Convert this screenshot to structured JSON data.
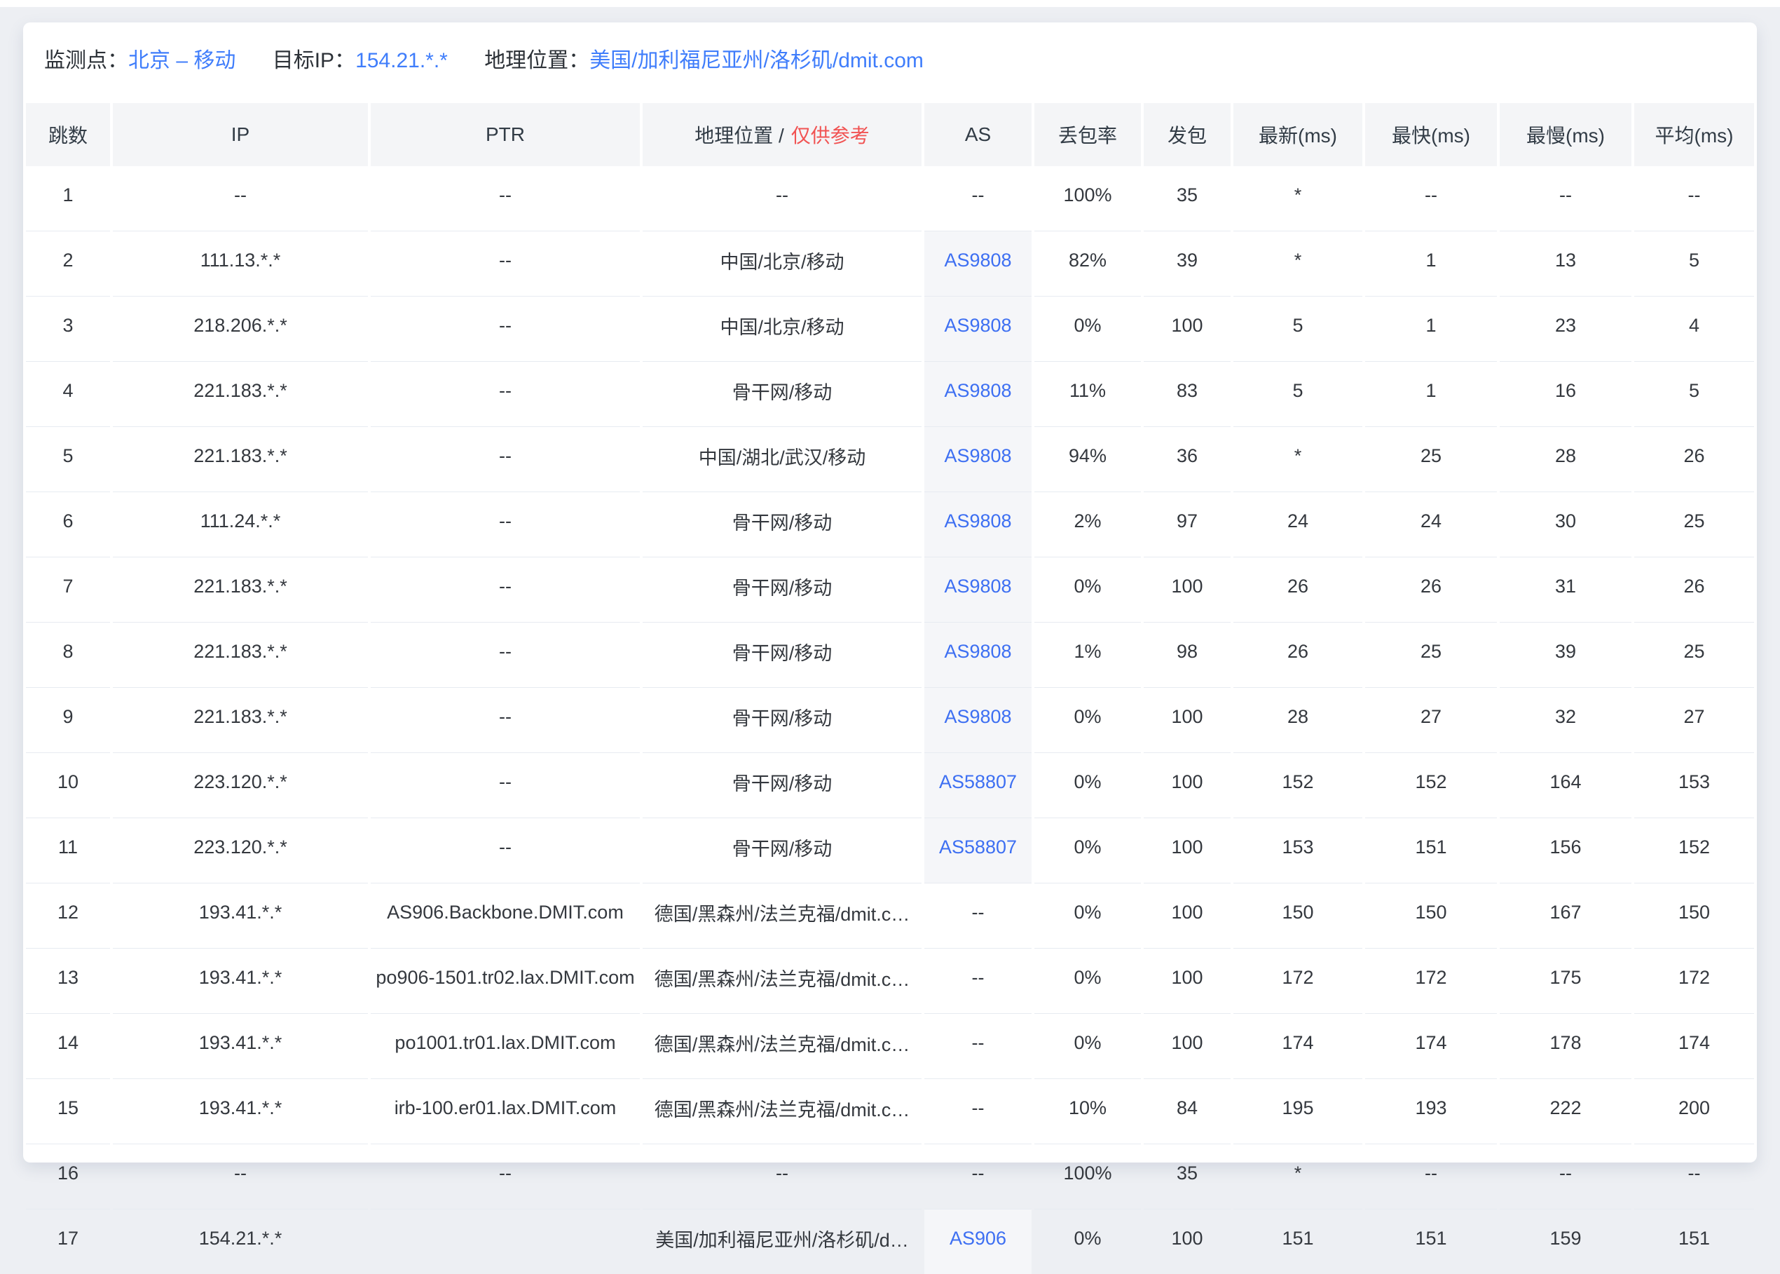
{
  "colors": {
    "page_background": "#edeff3",
    "link_blue": "#3f7dfb",
    "as_link_blue": "#3d6ff2",
    "warning_red": "#f15353",
    "header_cell_bg": "#f4f5f7",
    "as_cell_bg": "#f5f6f9"
  },
  "info": {
    "monitor_label": "监测点：",
    "monitor_value": "北京 – 移动",
    "target_ip_label": "目标IP：",
    "target_ip_value": "154.21.*.*",
    "location_label": "地理位置：",
    "location_value": "美国/加利福尼亚州/洛杉矶/dmit.com"
  },
  "table": {
    "columns": [
      "跳数",
      "IP",
      "PTR",
      "地理位置 /",
      "AS",
      "丢包率",
      "发包",
      "最新(ms)",
      "最快(ms)",
      "最慢(ms)",
      "平均(ms)"
    ],
    "geo_note": "仅供参考",
    "rows": [
      {
        "hop": "1",
        "ip": "--",
        "ptr": "--",
        "geo": "--",
        "as": "--",
        "as_link": false,
        "loss": "100%",
        "sent": "35",
        "latest": "*",
        "fastest": "--",
        "slowest": "--",
        "avg": "--"
      },
      {
        "hop": "2",
        "ip": "111.13.*.*",
        "ptr": "--",
        "geo": "中国/北京/移动",
        "as": "AS9808",
        "as_link": true,
        "loss": "82%",
        "sent": "39",
        "latest": "*",
        "fastest": "1",
        "slowest": "13",
        "avg": "5"
      },
      {
        "hop": "3",
        "ip": "218.206.*.*",
        "ptr": "--",
        "geo": "中国/北京/移动",
        "as": "AS9808",
        "as_link": true,
        "loss": "0%",
        "sent": "100",
        "latest": "5",
        "fastest": "1",
        "slowest": "23",
        "avg": "4"
      },
      {
        "hop": "4",
        "ip": "221.183.*.*",
        "ptr": "--",
        "geo": "骨干网/移动",
        "as": "AS9808",
        "as_link": true,
        "loss": "11%",
        "sent": "83",
        "latest": "5",
        "fastest": "1",
        "slowest": "16",
        "avg": "5"
      },
      {
        "hop": "5",
        "ip": "221.183.*.*",
        "ptr": "--",
        "geo": "中国/湖北/武汉/移动",
        "as": "AS9808",
        "as_link": true,
        "loss": "94%",
        "sent": "36",
        "latest": "*",
        "fastest": "25",
        "slowest": "28",
        "avg": "26"
      },
      {
        "hop": "6",
        "ip": "111.24.*.*",
        "ptr": "--",
        "geo": "骨干网/移动",
        "as": "AS9808",
        "as_link": true,
        "loss": "2%",
        "sent": "97",
        "latest": "24",
        "fastest": "24",
        "slowest": "30",
        "avg": "25"
      },
      {
        "hop": "7",
        "ip": "221.183.*.*",
        "ptr": "--",
        "geo": "骨干网/移动",
        "as": "AS9808",
        "as_link": true,
        "loss": "0%",
        "sent": "100",
        "latest": "26",
        "fastest": "26",
        "slowest": "31",
        "avg": "26"
      },
      {
        "hop": "8",
        "ip": "221.183.*.*",
        "ptr": "--",
        "geo": "骨干网/移动",
        "as": "AS9808",
        "as_link": true,
        "loss": "1%",
        "sent": "98",
        "latest": "26",
        "fastest": "25",
        "slowest": "39",
        "avg": "25"
      },
      {
        "hop": "9",
        "ip": "221.183.*.*",
        "ptr": "--",
        "geo": "骨干网/移动",
        "as": "AS9808",
        "as_link": true,
        "loss": "0%",
        "sent": "100",
        "latest": "28",
        "fastest": "27",
        "slowest": "32",
        "avg": "27"
      },
      {
        "hop": "10",
        "ip": "223.120.*.*",
        "ptr": "--",
        "geo": "骨干网/移动",
        "as": "AS58807",
        "as_link": true,
        "loss": "0%",
        "sent": "100",
        "latest": "152",
        "fastest": "152",
        "slowest": "164",
        "avg": "153"
      },
      {
        "hop": "11",
        "ip": "223.120.*.*",
        "ptr": "--",
        "geo": "骨干网/移动",
        "as": "AS58807",
        "as_link": true,
        "loss": "0%",
        "sent": "100",
        "latest": "153",
        "fastest": "151",
        "slowest": "156",
        "avg": "152"
      },
      {
        "hop": "12",
        "ip": "193.41.*.*",
        "ptr": "AS906.Backbone.DMIT.com",
        "geo": "德国/黑森州/法兰克福/dmit.c…",
        "as": "--",
        "as_link": false,
        "loss": "0%",
        "sent": "100",
        "latest": "150",
        "fastest": "150",
        "slowest": "167",
        "avg": "150"
      },
      {
        "hop": "13",
        "ip": "193.41.*.*",
        "ptr": "po906-1501.tr02.lax.DMIT.com",
        "geo": "德国/黑森州/法兰克福/dmit.c…",
        "as": "--",
        "as_link": false,
        "loss": "0%",
        "sent": "100",
        "latest": "172",
        "fastest": "172",
        "slowest": "175",
        "avg": "172"
      },
      {
        "hop": "14",
        "ip": "193.41.*.*",
        "ptr": "po1001.tr01.lax.DMIT.com",
        "geo": "德国/黑森州/法兰克福/dmit.c…",
        "as": "--",
        "as_link": false,
        "loss": "0%",
        "sent": "100",
        "latest": "174",
        "fastest": "174",
        "slowest": "178",
        "avg": "174"
      },
      {
        "hop": "15",
        "ip": "193.41.*.*",
        "ptr": "irb-100.er01.lax.DMIT.com",
        "geo": "德国/黑森州/法兰克福/dmit.c…",
        "as": "--",
        "as_link": false,
        "loss": "10%",
        "sent": "84",
        "latest": "195",
        "fastest": "193",
        "slowest": "222",
        "avg": "200"
      },
      {
        "hop": "16",
        "ip": "--",
        "ptr": "--",
        "geo": "--",
        "as": "--",
        "as_link": false,
        "loss": "100%",
        "sent": "35",
        "latest": "*",
        "fastest": "--",
        "slowest": "--",
        "avg": "--"
      },
      {
        "hop": "17",
        "ip": "154.21.*.*",
        "ptr": "",
        "geo": "美国/加利福尼亚州/洛杉矶/d…",
        "as": "AS906",
        "as_link": true,
        "loss": "0%",
        "sent": "100",
        "latest": "151",
        "fastest": "151",
        "slowest": "159",
        "avg": "151"
      }
    ]
  }
}
